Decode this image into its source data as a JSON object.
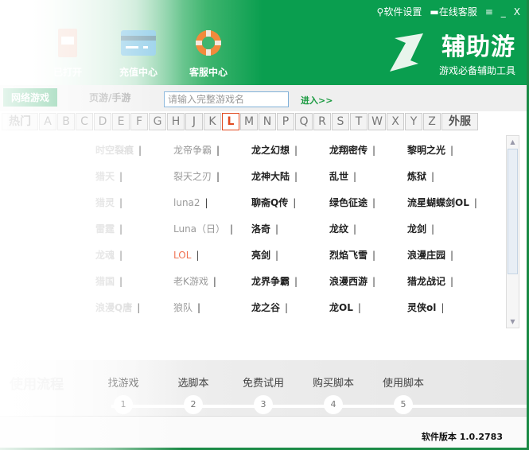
{
  "topbar": {
    "settings": "软件设置",
    "support": "在线客服",
    "menu_icon": "menu-icon",
    "minimize": "_",
    "close": "X"
  },
  "nav": [
    {
      "label": "已打开",
      "icon": "document-icon"
    },
    {
      "label": "充值中心",
      "icon": "card-icon"
    },
    {
      "label": "客服中心",
      "icon": "lifebuoy-icon"
    }
  ],
  "brand": {
    "title": "辅助游",
    "subtitle": "游戏必备辅助工具"
  },
  "tabs": {
    "active": "网络游戏",
    "second": "页游/手游"
  },
  "search": {
    "placeholder": "请输入完整游戏名",
    "value": "",
    "go": "进入>>"
  },
  "letters": [
    "热门",
    "A",
    "B",
    "C",
    "D",
    "E",
    "F",
    "G",
    "H",
    "J",
    "K",
    "L",
    "M",
    "N",
    "P",
    "Q",
    "R",
    "S",
    "T",
    "W",
    "X",
    "Y",
    "Z",
    "外服"
  ],
  "selected_letter": "L",
  "games": [
    [
      "时空裂痕",
      "龙帝争霸",
      "龙之幻想",
      "龙翔密传",
      "黎明之光"
    ],
    [
      "猎天",
      "裂天之刃",
      "龙神大陆",
      "乱世",
      "炼狱"
    ],
    [
      "猎灵",
      "luna2",
      "聊斋Q传",
      "绿色征途",
      "流星蝴蝶剑OL"
    ],
    [
      "雷霆",
      "Luna（日）",
      "洛奇",
      "龙纹",
      "龙剑"
    ],
    [
      "龙魂",
      "LOL",
      "亮剑",
      "烈焰飞雪",
      "浪漫庄园"
    ],
    [
      "猎国",
      "老K游戏",
      "龙界争霸",
      "浪漫西游",
      "猎龙战记"
    ],
    [
      "浪漫Q唐",
      "狼队",
      "龙之谷",
      "龙OL",
      "灵侠ol"
    ]
  ],
  "separator": "|",
  "flow": {
    "title": "使用流程",
    "steps": [
      {
        "n": "1",
        "label": "找游戏"
      },
      {
        "n": "2",
        "label": "选脚本"
      },
      {
        "n": "3",
        "label": "免费试用"
      },
      {
        "n": "4",
        "label": "购买脚本"
      },
      {
        "n": "5",
        "label": "使用脚本"
      }
    ]
  },
  "footer": {
    "version": "软件版本 1.0.2783"
  },
  "colors": {
    "brand": "#0a9e4f",
    "selected": "#e04a20"
  }
}
